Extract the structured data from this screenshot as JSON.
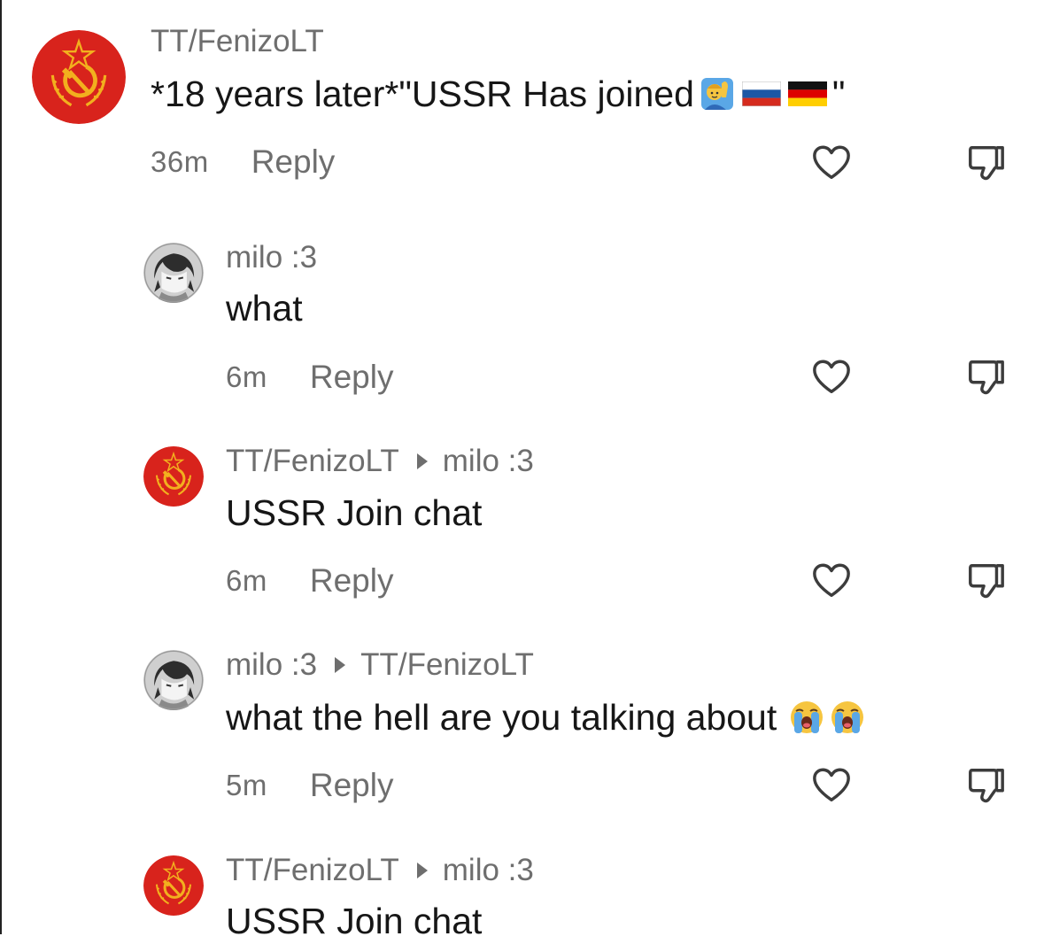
{
  "comments": [
    {
      "avatar": "ussr-emblem",
      "username": "TT/FenizoLT",
      "reply_to": "",
      "text": "*18 years later*\"USSR Has joined",
      "text_emojis": [
        "man-raising-hand",
        "russia-flag",
        "germany-flag"
      ],
      "text_suffix": "\"",
      "time": "36m",
      "reply_label": "Reply"
    },
    {
      "avatar": "anime-character",
      "username": "milo :3",
      "reply_to": "",
      "text": "what",
      "time": "6m",
      "reply_label": "Reply"
    },
    {
      "avatar": "ussr-emblem",
      "username": "TT/FenizoLT",
      "reply_to": "milo :3",
      "text": "USSR Join chat",
      "time": "6m",
      "reply_label": "Reply"
    },
    {
      "avatar": "anime-character",
      "username": "milo :3",
      "reply_to": "TT/FenizoLT",
      "text": "what the hell are you talking about",
      "text_emojis": [
        "loudly-crying-face",
        "loudly-crying-face"
      ],
      "time": "5m",
      "reply_label": "Reply"
    },
    {
      "avatar": "ussr-emblem",
      "username": "TT/FenizoLT",
      "reply_to": "milo :3",
      "text": "USSR Join chat"
    }
  ]
}
